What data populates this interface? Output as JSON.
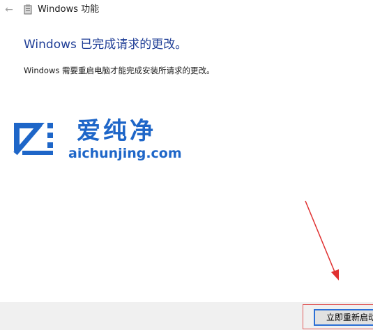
{
  "window": {
    "title": "Windows 功能",
    "back_icon": "back-arrow-icon",
    "app_icon": "windows-features-icon"
  },
  "main": {
    "heading": "Windows 已完成请求的更改。",
    "message": "Windows 需要重启电脑才能完成安装所请求的更改。"
  },
  "watermark": {
    "name": "爱纯净",
    "url": "aichunjing.com",
    "color": "#1e66c8"
  },
  "footer": {
    "restart_label": "立即重新启动"
  },
  "colors": {
    "heading": "#1e3d96",
    "annotation_red": "#e03030",
    "button_focus_border": "#2b6fd6"
  }
}
